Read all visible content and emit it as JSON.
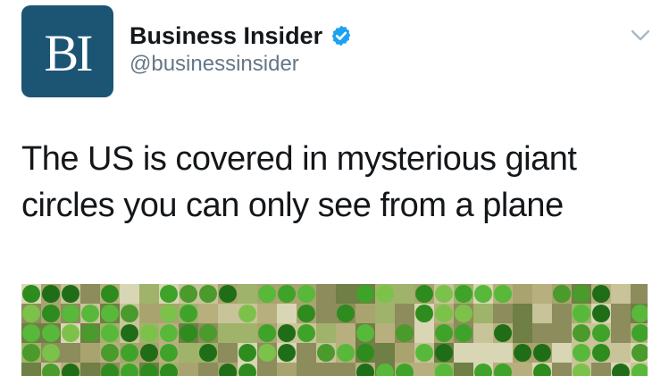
{
  "tweet": {
    "avatar": {
      "text": "BI",
      "background": "#1c5573"
    },
    "author": {
      "name": "Business Insider",
      "handle": "@businessinsider",
      "verified": true
    },
    "menu_icon": "chevron-down-icon",
    "text": "The US is covered in mysterious giant circles you can only see from a plane",
    "media": {
      "kind": "photo",
      "icon": "aerial-farmland-image"
    }
  },
  "colors": {
    "verified_badge": "#1da1f2",
    "name_text": "#14171a",
    "handle_text": "#657786",
    "caret": "#aab8c2"
  }
}
